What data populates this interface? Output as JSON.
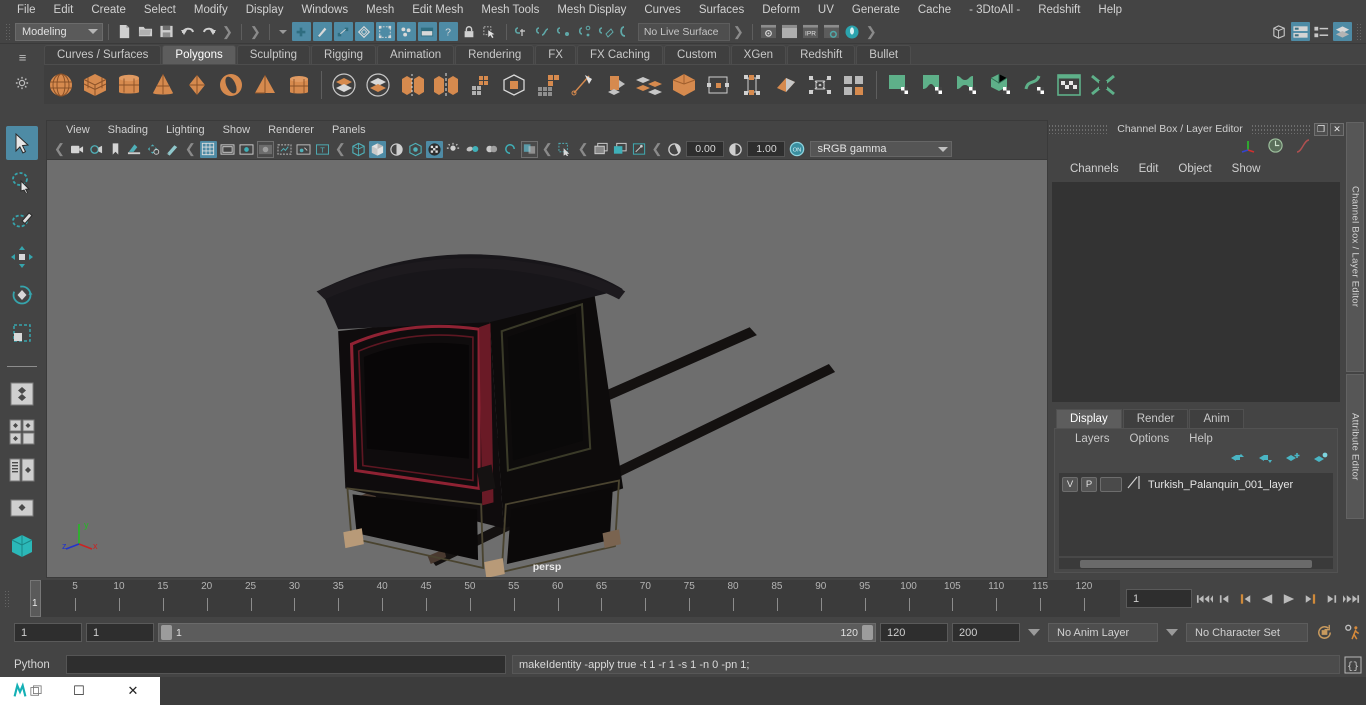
{
  "app": {
    "title": "Autodesk Maya"
  },
  "menubar": {
    "items": [
      "File",
      "Edit",
      "Create",
      "Select",
      "Modify",
      "Display",
      "Windows",
      "Mesh",
      "Edit Mesh",
      "Mesh Tools",
      "Mesh Display",
      "Curves",
      "Surfaces",
      "Deform",
      "UV",
      "Generate",
      "Cache",
      "- 3DtoAll -",
      "Redshift",
      "Help"
    ]
  },
  "statusbar": {
    "mode": "Modeling",
    "live_surface": "No Live Surface",
    "icons": [
      "new-scene-icon",
      "open-scene-icon",
      "save-scene-icon",
      "undo-icon",
      "redo-icon",
      "select-hierarchy-icon",
      "select-object-icon",
      "select-component-icon",
      "snap-grid-icon",
      "snap-curve-icon",
      "snap-point-icon",
      "snap-view-plane-icon",
      "snap-surface-icon",
      "make-live-icon",
      "render-view-icon",
      "render-region-icon",
      "ipr-render-icon",
      "render-settings-icon",
      "hypershade-icon",
      "toggle-attribute-editor-icon",
      "toggle-channel-box-icon",
      "toggle-tool-settings-icon",
      "toggle-layer-editor-icon"
    ],
    "mask_icons": [
      "select-by-hierarchy-icon",
      "select-by-object-icon",
      "select-by-component-icon",
      "lock-icon",
      "selection-mask-icon"
    ]
  },
  "shelf": {
    "tabs": [
      "Curves / Surfaces",
      "Polygons",
      "Sculpting",
      "Rigging",
      "Animation",
      "Rendering",
      "FX",
      "FX Caching",
      "Custom",
      "XGen",
      "Redshift",
      "Bullet"
    ],
    "active_tab": "Polygons",
    "icons": [
      "poly-sphere-icon",
      "poly-cube-icon",
      "poly-cylinder-icon",
      "poly-cone-icon",
      "poly-octahedron-icon",
      "poly-torus-icon",
      "poly-pyramid-icon",
      "poly-prism-icon",
      "boolean-union-icon",
      "boolean-difference-icon",
      "combine-icon",
      "mirror-icon",
      "quad-draw-icon",
      "extrude-icon",
      "bevel-icon",
      "multi-cut-icon",
      "smooth-icon",
      "subdiv-proxy-icon",
      "target-weld-icon",
      "crease-tool-icon",
      "bridge-icon",
      "connect-icon",
      "append-polygon-icon",
      "uv-editor-icon",
      "auto-uv-icon",
      "planar-map-icon",
      "cylindrical-map-icon",
      "uv-unfold-icon",
      "uv-snapshot-icon",
      "uv-layout-icon"
    ]
  },
  "toolbox": {
    "tools": [
      "select-tool",
      "lasso-select-tool",
      "paint-select-tool",
      "move-tool",
      "rotate-tool",
      "scale-tool"
    ],
    "layouts": [
      "single-perspective-layout",
      "four-view-layout",
      "outliner-persp-layout",
      "hypergraph-persp-layout",
      "persp-graph-layout"
    ],
    "selected": "select-tool"
  },
  "viewport": {
    "menus": [
      "View",
      "Shading",
      "Lighting",
      "Show",
      "Renderer",
      "Panels"
    ],
    "camera_label": "persp",
    "exposure": "0.00",
    "gamma": "1.00",
    "view_transform": "sRGB gamma",
    "background_color": "#6e6e6e",
    "axis_gizmo": {
      "x": "x",
      "y": "y",
      "z": "z",
      "x_color": "#cc2222",
      "y_color": "#22bb22",
      "z_color": "#2233cc"
    },
    "model": "Turkish Palanquin"
  },
  "channel_box": {
    "panel_title": "Channel Box / Layer Editor",
    "menus": [
      "Channels",
      "Edit",
      "Object",
      "Show"
    ],
    "window_buttons": [
      "restore-window-icon",
      "close-window-icon"
    ],
    "header_icons": [
      "axis-display-icon",
      "clock-display-icon",
      "curve-display-icon"
    ]
  },
  "layer_editor": {
    "tabs": [
      "Display",
      "Render",
      "Anim"
    ],
    "active_tab": "Display",
    "menus": [
      "Layers",
      "Options",
      "Help"
    ],
    "buttons": [
      "move-layer-up-icon",
      "move-layer-down-icon",
      "new-layer-icon",
      "new-layer-from-selected-icon"
    ],
    "layers": [
      {
        "visibility": "V",
        "playback": "P",
        "color": "",
        "name": "Turkish_Palanquin_001_layer"
      }
    ]
  },
  "sidetabs": [
    "Channel Box / Layer Editor",
    "Attribute Editor"
  ],
  "timeline": {
    "ticks": [
      5,
      10,
      15,
      20,
      25,
      30,
      35,
      40,
      45,
      50,
      55,
      60,
      65,
      70,
      75,
      80,
      85,
      90,
      95,
      100,
      105,
      110,
      115,
      120
    ],
    "start": 1,
    "end": 120,
    "current_frame": "1",
    "current_frame_field": "1",
    "playback_buttons": [
      "go-to-start-icon",
      "step-back-keyframe-icon",
      "step-back-frame-icon",
      "play-backwards-icon",
      "play-forwards-icon",
      "step-forward-frame-icon",
      "step-forward-keyframe-icon",
      "go-to-end-icon"
    ]
  },
  "range": {
    "anim_start": "1",
    "range_start": "1",
    "slider_min": "1",
    "slider_max": "120",
    "range_end": "120",
    "anim_end": "200",
    "anim_layer": "No Anim Layer",
    "character_set": "No Character Set",
    "right_icons": [
      "auto-keyframe-icon",
      "animation-preferences-icon"
    ]
  },
  "command_line": {
    "language": "Python",
    "input_value": "",
    "output": "makeIdentity -apply true -t 1 -r 1 -s 1 -n 0 -pn 1;",
    "script_editor_icon": "script-editor-icon"
  },
  "taskbar": {
    "app_icon": "maya-app-icon",
    "restore_icon": "restore-icon",
    "minimize_label": "☐",
    "close_label": "✕"
  },
  "colors": {
    "accent_blue": "#4e8ba5",
    "shelf_orange": "#d68a4e",
    "shelf_green": "#5eb089",
    "panel_bg": "#444444",
    "viewport_bg": "#6e6e6e"
  }
}
